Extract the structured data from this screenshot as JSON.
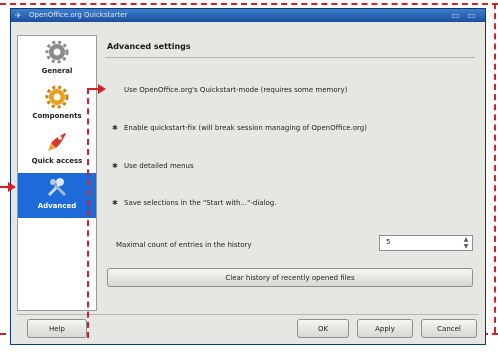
{
  "window": {
    "title": "OpenOffice.org Quickstarter"
  },
  "sidebar": {
    "items": [
      {
        "label": "General",
        "icon": "gear-icon",
        "active": false
      },
      {
        "label": "Components",
        "icon": "components-icon",
        "active": false
      },
      {
        "label": "Quick access",
        "icon": "rocket-icon",
        "active": false
      },
      {
        "label": "Advanced",
        "icon": "advanced-tools-icon",
        "active": true
      }
    ]
  },
  "content": {
    "title": "Advanced settings",
    "options": [
      {
        "label": "Use OpenOffice.org's Quickstart-mode (requires some memory)",
        "checked": false
      },
      {
        "label": "Enable quickstart-fix (will break session managing of OpenOffice.org)",
        "checked": true
      },
      {
        "label": "Use detailed menus",
        "checked": true
      },
      {
        "label": "Save selections in the \"Start with...\"-dialog.",
        "checked": true
      }
    ],
    "history": {
      "label": "Maximal count of entries in the history",
      "value": "5"
    },
    "clear_button": "Clear history of recently opened files"
  },
  "buttons": {
    "help": "Help",
    "ok": "OK",
    "apply": "Apply",
    "cancel": "Cancel"
  },
  "colors": {
    "accent": "#1e6ad9",
    "annotation": "#d0222a",
    "titlebar": "#2a64b4"
  }
}
